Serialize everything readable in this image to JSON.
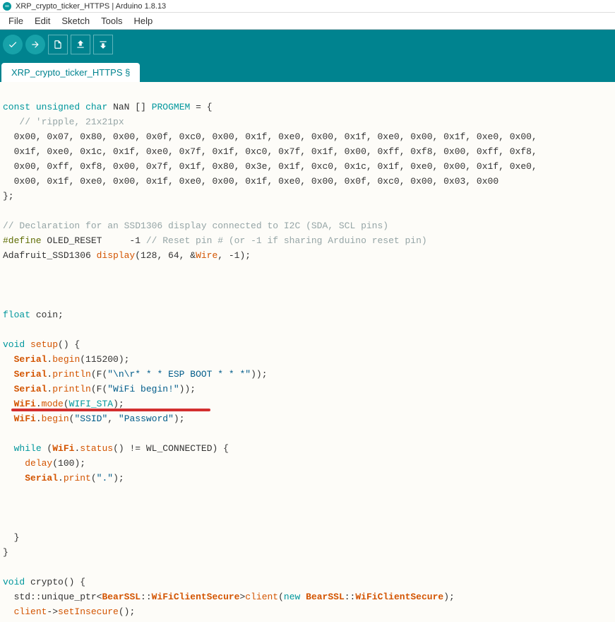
{
  "titlebar": {
    "title": "XRP_crypto_ticker_HTTPS | Arduino 1.8.13"
  },
  "menubar": {
    "items": [
      "File",
      "Edit",
      "Sketch",
      "Tools",
      "Help"
    ]
  },
  "tab": {
    "label": "XRP_crypto_ticker_HTTPS §"
  },
  "code": {
    "l1_const": "const",
    "l1_unsigned": "unsigned",
    "l1_char": "char",
    "l1_nan": " NaN [] ",
    "l1_progmem": "PROGMEM",
    "l1_end": " = {",
    "l2_cmt": "   // 'ripple, 21x21px",
    "l3": "  0x00, 0x07, 0x80, 0x00, 0x0f, 0xc0, 0x00, 0x1f, 0xe0, 0x00, 0x1f, 0xe0, 0x00, 0x1f, 0xe0, 0x00,",
    "l4": "  0x1f, 0xe0, 0x1c, 0x1f, 0xe0, 0x7f, 0x1f, 0xc0, 0x7f, 0x1f, 0x00, 0xff, 0xf8, 0x00, 0xff, 0xf8,",
    "l5": "  0x00, 0xff, 0xf8, 0x00, 0x7f, 0x1f, 0x80, 0x3e, 0x1f, 0xc0, 0x1c, 0x1f, 0xe0, 0x00, 0x1f, 0xe0,",
    "l6": "  0x00, 0x1f, 0xe0, 0x00, 0x1f, 0xe0, 0x00, 0x1f, 0xe0, 0x00, 0x0f, 0xc0, 0x00, 0x03, 0x00",
    "l7": "};",
    "l9_cmt": "// Declaration for an SSD1306 display connected to I2C (SDA, SCL pins)",
    "l10_def": "#define",
    "l10_rest": " OLED_RESET     -1 ",
    "l10_cmt": "// Reset pin # (or -1 if sharing Arduino reset pin)",
    "l11_a": "Adafruit_SSD1306 ",
    "l11_display": "display",
    "l11_b": "(128, 64, &",
    "l11_wire": "Wire",
    "l11_c": ", -1);",
    "l14_float": "float",
    "l14_rest": " coin;",
    "l16_void": "void",
    "l16_setup": " setup",
    "l16_rest": "() {",
    "l17_serial": "Serial",
    "l17_dot": ".",
    "l17_begin": "begin",
    "l17_rest": "(115200);",
    "l18_serial": "Serial",
    "l18_println": "println",
    "l18_a": "(F(",
    "l18_str": "\"\\n\\r* * * ESP BOOT * * *\"",
    "l18_b": "));",
    "l19_serial": "Serial",
    "l19_println": "println",
    "l19_a": "(F(",
    "l19_str": "\"WiFi begin!\"",
    "l19_b": "));",
    "l20_wifi": "WiFi",
    "l20_mode": "mode",
    "l20_a": "(",
    "l20_wifista": "WIFI_STA",
    "l20_b": ");",
    "l21_wifi": "WiFi",
    "l21_begin": "begin",
    "l21_a": "(",
    "l21_ssid": "\"SSID\"",
    "l21_c": ", ",
    "l21_pw": "\"Password\"",
    "l21_b": ");",
    "l23_while": "while",
    "l23_a": " (",
    "l23_wifi": "WiFi",
    "l23_status": "status",
    "l23_b": "() != WL_CONNECTED) {",
    "l24_delay": "delay",
    "l24_rest": "(100);",
    "l25_serial": "Serial",
    "l25_print": "print",
    "l25_a": "(",
    "l25_str": "\".\"",
    "l25_b": ");",
    "l29_a": "  }",
    "l30_a": "}",
    "l32_void": "void",
    "l32_rest": " crypto() {",
    "l33_a": "  std::unique_ptr<",
    "l33_bearssl1": "BearSSL",
    "l33_b": "::",
    "l33_wcs1": "WiFiClientSecure",
    "l33_c": ">",
    "l33_client": "client",
    "l33_d": "(",
    "l33_new": "new",
    "l33_e": " ",
    "l33_bearssl2": "BearSSL",
    "l33_f": "::",
    "l33_wcs2": "WiFiClientSecure",
    "l33_g": ");",
    "l34_a": "  ",
    "l34_client": "client",
    "l34_b": "->",
    "l34_setins": "setInsecure",
    "l34_c": "();"
  }
}
